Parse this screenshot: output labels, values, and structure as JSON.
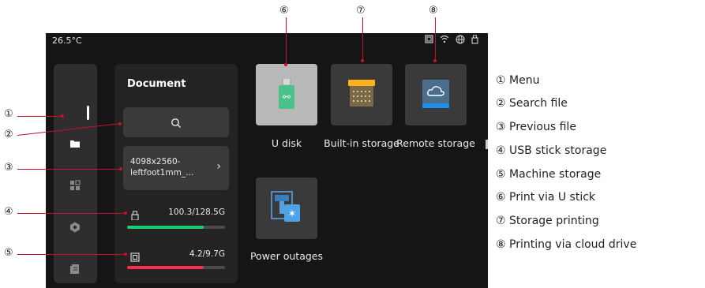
{
  "status_bar": {
    "temperature": "26.5°C",
    "icons": [
      "device-icon",
      "wifi-icon",
      "globe-icon",
      "usb-icon"
    ]
  },
  "sidebar": {
    "items": [
      {
        "icon": "folder-icon",
        "active": true
      },
      {
        "icon": "apps-icon",
        "active": false
      },
      {
        "icon": "settings-icon",
        "active": false
      },
      {
        "icon": "history-icon",
        "active": false
      }
    ]
  },
  "document_panel": {
    "title": "Document",
    "previous_file": "4098x2560-leftfoot1mm_…",
    "usb_storage": {
      "value": "100.3/128.5G",
      "fraction": 0.78,
      "color": "#1ec97a"
    },
    "machine_storage": {
      "value": "4.2/9.7G",
      "fraction": 0.78,
      "color": "#ff2d4f"
    }
  },
  "tiles": [
    {
      "label": "U disk",
      "icon": "usb-stick-icon"
    },
    {
      "label": "Built-in storage",
      "icon": "internal-storage-icon"
    },
    {
      "label": "Remote storage",
      "icon": "cloud-storage-icon"
    },
    {
      "label": "Power outages",
      "icon": "power-outage-icon"
    }
  ],
  "callouts": [
    "①",
    "②",
    "③",
    "④",
    "⑤",
    "⑥",
    "⑦",
    "⑧"
  ],
  "legend": [
    "① Menu",
    "② Search file",
    "③ Previous file",
    "④ USB stick storage",
    "⑤ Machine storage",
    "⑥ Print via U stick",
    "⑦ Storage printing",
    "⑧ Printing via cloud drive"
  ],
  "colors": {
    "callout_line": "#c8102e",
    "screen_bg": "#151515"
  }
}
